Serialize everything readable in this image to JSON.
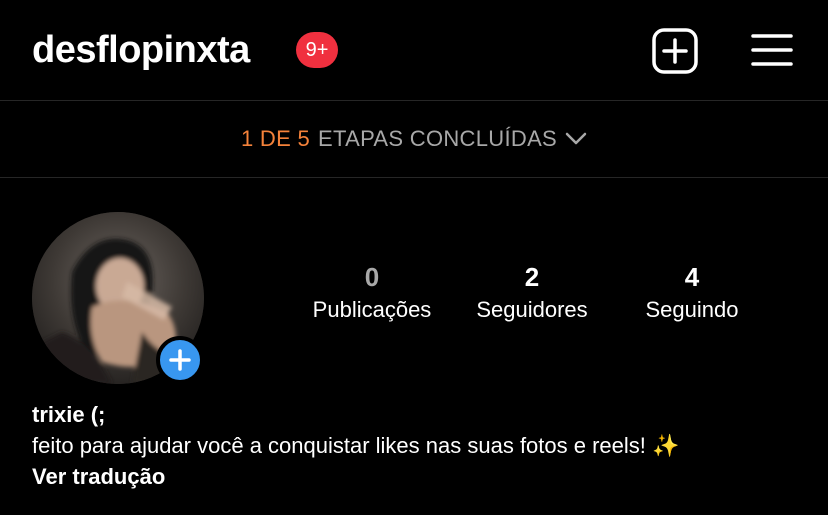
{
  "header": {
    "username": "desflopinxta",
    "notification_badge": "9+",
    "new_post_icon": "plus-square-icon",
    "menu_icon": "hamburger-menu-icon"
  },
  "steps_banner": {
    "progress": "1 DE 5",
    "label": "ETAPAS CONCLUÍDAS",
    "icon": "chevron-down-icon"
  },
  "profile": {
    "add_story_icon": "plus-icon",
    "stats": [
      {
        "value": "0",
        "label": "Publicações"
      },
      {
        "value": "2",
        "label": "Seguidores"
      },
      {
        "value": "4",
        "label": "Seguindo"
      }
    ]
  },
  "bio": {
    "name": "trixie (;",
    "text": "feito para ajudar você a conquistar likes nas suas fotos e reels! ✨",
    "translate_link": "Ver tradução"
  },
  "colors": {
    "background": "#000000",
    "progress_accent": "#f5823a",
    "badge": "#f0303f",
    "add_story": "#3897f0",
    "divider": "#262626"
  }
}
